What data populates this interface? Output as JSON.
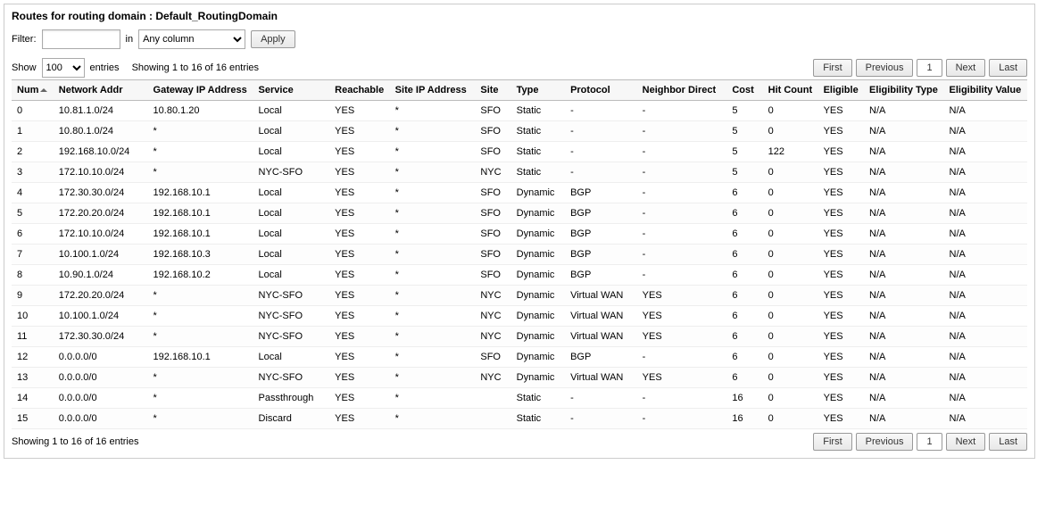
{
  "panel_title": "Routes for routing domain : Default_RoutingDomain",
  "filter": {
    "label": "Filter:",
    "value": "",
    "in_label": "in",
    "column_selected": "Any column",
    "apply_label": "Apply"
  },
  "show": {
    "label": "Show",
    "value": "100",
    "entries_label": "entries"
  },
  "info_text_top": "Showing 1 to 16 of 16 entries",
  "info_text_bottom": "Showing 1 to 16 of 16 entries",
  "pager": {
    "first": "First",
    "previous": "Previous",
    "next": "Next",
    "last": "Last",
    "page": "1"
  },
  "columns": [
    "Num",
    "Network Addr",
    "Gateway IP Address",
    "Service",
    "Reachable",
    "Site IP Address",
    "Site",
    "Type",
    "Protocol",
    "Neighbor Direct",
    "Cost",
    "Hit Count",
    "Eligible",
    "Eligibility Type",
    "Eligibility Value"
  ],
  "rows": [
    {
      "num": "0",
      "net": "10.81.1.0/24",
      "gw": "10.80.1.20",
      "svc": "Local",
      "reach": "YES",
      "siteip": "*",
      "site": "SFO",
      "type": "Static",
      "proto": "-",
      "nd": "-",
      "cost": "5",
      "hits": "0",
      "elig": "YES",
      "etype": "N/A",
      "eval": "N/A"
    },
    {
      "num": "1",
      "net": "10.80.1.0/24",
      "gw": "*",
      "svc": "Local",
      "reach": "YES",
      "siteip": "*",
      "site": "SFO",
      "type": "Static",
      "proto": "-",
      "nd": "-",
      "cost": "5",
      "hits": "0",
      "elig": "YES",
      "etype": "N/A",
      "eval": "N/A"
    },
    {
      "num": "2",
      "net": "192.168.10.0/24",
      "gw": "*",
      "svc": "Local",
      "reach": "YES",
      "siteip": "*",
      "site": "SFO",
      "type": "Static",
      "proto": "-",
      "nd": "-",
      "cost": "5",
      "hits": "122",
      "elig": "YES",
      "etype": "N/A",
      "eval": "N/A"
    },
    {
      "num": "3",
      "net": "172.10.10.0/24",
      "gw": "*",
      "svc": "NYC-SFO",
      "reach": "YES",
      "siteip": "*",
      "site": "NYC",
      "type": "Static",
      "proto": "-",
      "nd": "-",
      "cost": "5",
      "hits": "0",
      "elig": "YES",
      "etype": "N/A",
      "eval": "N/A"
    },
    {
      "num": "4",
      "net": "172.30.30.0/24",
      "gw": "192.168.10.1",
      "svc": "Local",
      "reach": "YES",
      "siteip": "*",
      "site": "SFO",
      "type": "Dynamic",
      "proto": "BGP",
      "nd": "-",
      "cost": "6",
      "hits": "0",
      "elig": "YES",
      "etype": "N/A",
      "eval": "N/A"
    },
    {
      "num": "5",
      "net": "172.20.20.0/24",
      "gw": "192.168.10.1",
      "svc": "Local",
      "reach": "YES",
      "siteip": "*",
      "site": "SFO",
      "type": "Dynamic",
      "proto": "BGP",
      "nd": "-",
      "cost": "6",
      "hits": "0",
      "elig": "YES",
      "etype": "N/A",
      "eval": "N/A"
    },
    {
      "num": "6",
      "net": "172.10.10.0/24",
      "gw": "192.168.10.1",
      "svc": "Local",
      "reach": "YES",
      "siteip": "*",
      "site": "SFO",
      "type": "Dynamic",
      "proto": "BGP",
      "nd": "-",
      "cost": "6",
      "hits": "0",
      "elig": "YES",
      "etype": "N/A",
      "eval": "N/A"
    },
    {
      "num": "7",
      "net": "10.100.1.0/24",
      "gw": "192.168.10.3",
      "svc": "Local",
      "reach": "YES",
      "siteip": "*",
      "site": "SFO",
      "type": "Dynamic",
      "proto": "BGP",
      "nd": "-",
      "cost": "6",
      "hits": "0",
      "elig": "YES",
      "etype": "N/A",
      "eval": "N/A"
    },
    {
      "num": "8",
      "net": "10.90.1.0/24",
      "gw": "192.168.10.2",
      "svc": "Local",
      "reach": "YES",
      "siteip": "*",
      "site": "SFO",
      "type": "Dynamic",
      "proto": "BGP",
      "nd": "-",
      "cost": "6",
      "hits": "0",
      "elig": "YES",
      "etype": "N/A",
      "eval": "N/A"
    },
    {
      "num": "9",
      "net": "172.20.20.0/24",
      "gw": "*",
      "svc": "NYC-SFO",
      "reach": "YES",
      "siteip": "*",
      "site": "NYC",
      "type": "Dynamic",
      "proto": "Virtual WAN",
      "nd": "YES",
      "cost": "6",
      "hits": "0",
      "elig": "YES",
      "etype": "N/A",
      "eval": "N/A"
    },
    {
      "num": "10",
      "net": "10.100.1.0/24",
      "gw": "*",
      "svc": "NYC-SFO",
      "reach": "YES",
      "siteip": "*",
      "site": "NYC",
      "type": "Dynamic",
      "proto": "Virtual WAN",
      "nd": "YES",
      "cost": "6",
      "hits": "0",
      "elig": "YES",
      "etype": "N/A",
      "eval": "N/A"
    },
    {
      "num": "11",
      "net": "172.30.30.0/24",
      "gw": "*",
      "svc": "NYC-SFO",
      "reach": "YES",
      "siteip": "*",
      "site": "NYC",
      "type": "Dynamic",
      "proto": "Virtual WAN",
      "nd": "YES",
      "cost": "6",
      "hits": "0",
      "elig": "YES",
      "etype": "N/A",
      "eval": "N/A"
    },
    {
      "num": "12",
      "net": "0.0.0.0/0",
      "gw": "192.168.10.1",
      "svc": "Local",
      "reach": "YES",
      "siteip": "*",
      "site": "SFO",
      "type": "Dynamic",
      "proto": "BGP",
      "nd": "-",
      "cost": "6",
      "hits": "0",
      "elig": "YES",
      "etype": "N/A",
      "eval": "N/A"
    },
    {
      "num": "13",
      "net": "0.0.0.0/0",
      "gw": "*",
      "svc": "NYC-SFO",
      "reach": "YES",
      "siteip": "*",
      "site": "NYC",
      "type": "Dynamic",
      "proto": "Virtual WAN",
      "nd": "YES",
      "cost": "6",
      "hits": "0",
      "elig": "YES",
      "etype": "N/A",
      "eval": "N/A"
    },
    {
      "num": "14",
      "net": "0.0.0.0/0",
      "gw": "*",
      "svc": "Passthrough",
      "reach": "YES",
      "siteip": "*",
      "site": "",
      "type": "Static",
      "proto": "-",
      "nd": "-",
      "cost": "16",
      "hits": "0",
      "elig": "YES",
      "etype": "N/A",
      "eval": "N/A"
    },
    {
      "num": "15",
      "net": "0.0.0.0/0",
      "gw": "*",
      "svc": "Discard",
      "reach": "YES",
      "siteip": "*",
      "site": "",
      "type": "Static",
      "proto": "-",
      "nd": "-",
      "cost": "16",
      "hits": "0",
      "elig": "YES",
      "etype": "N/A",
      "eval": "N/A"
    }
  ]
}
